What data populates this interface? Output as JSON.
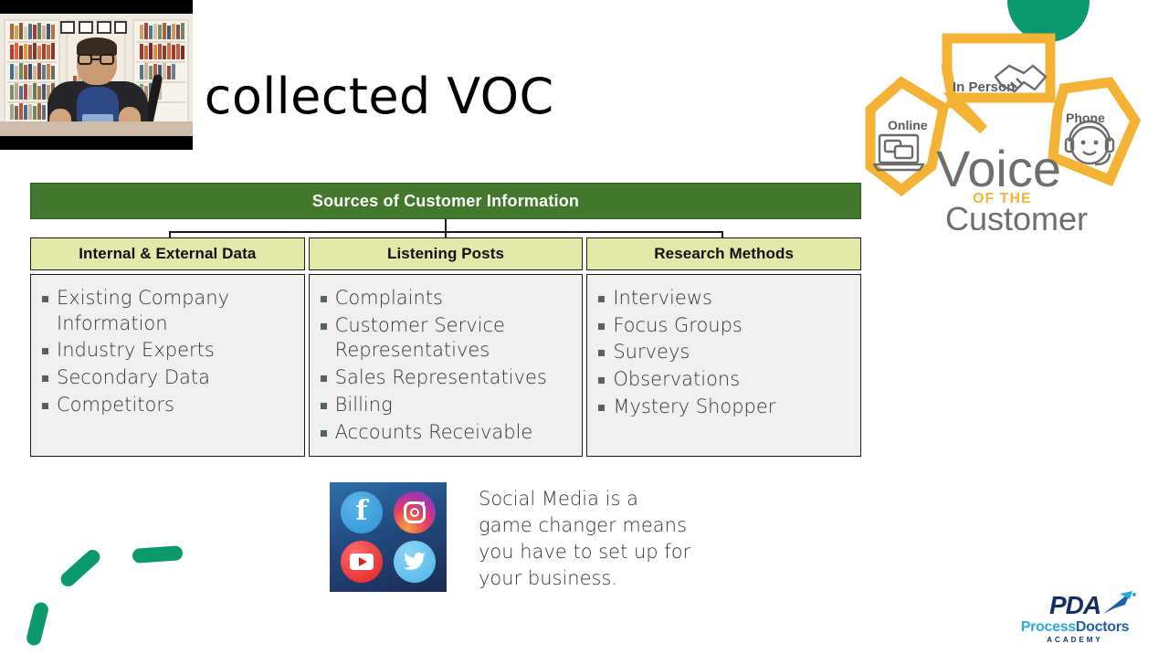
{
  "slide": {
    "title": "we collected VOC",
    "background_color": "#FFFFFF"
  },
  "decor": {
    "teal_color": "#0B9A6D",
    "semicircle_name": "teal-semicircle",
    "arc_name": "teal-dashed-arc"
  },
  "webcam": {
    "label": "presenter-webcam-overlay",
    "description": "Presenter speaking in front of bookshelves"
  },
  "voc_logo": {
    "brand_line1": "Voice",
    "brand_line2": "OF THE",
    "brand_line3": "Customer",
    "bubbles": [
      {
        "label": "Online",
        "icon": "laptop-chat-icon"
      },
      {
        "label": "In Person",
        "icon": "handshake-icon"
      },
      {
        "label": "Phone",
        "icon": "headset-agent-icon"
      }
    ],
    "accent_color": "#F5B335",
    "text_color": "#6E6E6E"
  },
  "diagram": {
    "header": "Sources of Customer Information",
    "header_bg": "#41782C",
    "header_text_color": "#FFFFFF",
    "subheader_bg": "#E2E8A8",
    "body_bg": "#F0F0F0",
    "columns": [
      {
        "heading": "Internal & External Data",
        "items": [
          "Existing Company Information",
          "Industry Experts",
          "Secondary Data",
          "Competitors"
        ]
      },
      {
        "heading": "Listening Posts",
        "items": [
          "Complaints",
          "Customer Service Representatives",
          "Sales Representatives",
          "Billing",
          "Accounts Receivable"
        ]
      },
      {
        "heading": "Research Methods",
        "items": [
          "Interviews",
          "Focus Groups",
          "Surveys",
          "Observations",
          "Mystery Shopper"
        ]
      }
    ]
  },
  "social": {
    "caption": "Social Media is a game changer means you have to set up for your business.",
    "icons": [
      {
        "name": "facebook-icon",
        "label": "Facebook"
      },
      {
        "name": "instagram-icon",
        "label": "Instagram"
      },
      {
        "name": "youtube-icon",
        "label": "YouTube"
      },
      {
        "name": "twitter-icon",
        "label": "Twitter"
      }
    ]
  },
  "pda_logo": {
    "mark": "PDA",
    "name_part1": "Process",
    "name_part2": "Doctors",
    "tagline": "ACADEMY",
    "navy": "#15305E",
    "cyan": "#2AA8E0"
  }
}
